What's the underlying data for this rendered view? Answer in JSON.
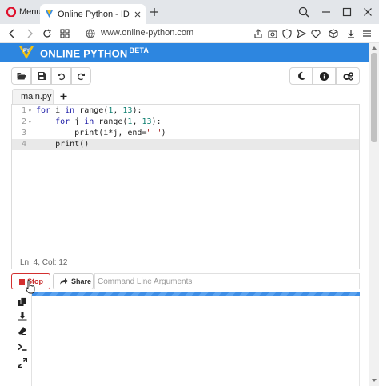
{
  "browser": {
    "menu_label": "Menu",
    "tab_title": "Online Python - IDE, Editor",
    "url": "www.online-python.com"
  },
  "site": {
    "brand": "ONLINE PYTHON",
    "brand_badge": "BETA",
    "logo_text": "PY",
    "accent_color": "#2d86e0"
  },
  "toolbar": {
    "left_icons": [
      "folder-open-icon",
      "save-icon",
      "undo-icon",
      "redo-icon"
    ],
    "right_icons": [
      "moon-icon",
      "info-icon",
      "settings-icon"
    ]
  },
  "editor": {
    "file_tab": "main.py",
    "add_tab_label": "+",
    "lines": [
      {
        "number": "1",
        "fold": "▾"
      },
      {
        "number": "2",
        "fold": "▾"
      },
      {
        "number": "3",
        "fold": ""
      },
      {
        "number": "4",
        "fold": ""
      }
    ],
    "status": "Ln: 4,  Col: 12"
  },
  "run": {
    "stop_label": "Stop",
    "share_label": "Share",
    "args_placeholder": "Command Line Arguments"
  },
  "output": {
    "side_icons": [
      "copy-icon",
      "download-icon",
      "eraser-icon",
      "terminal-icon",
      "expand-icon"
    ]
  }
}
